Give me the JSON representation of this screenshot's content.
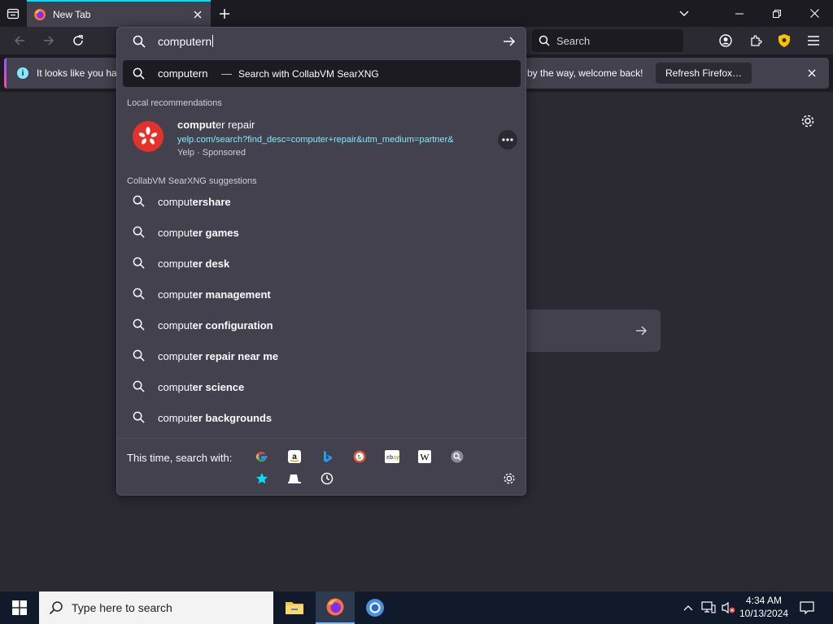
{
  "browser": {
    "tab": {
      "title": "New Tab"
    },
    "navbar": {
      "search_placeholder": "Search"
    },
    "notification": {
      "message_start": "It looks like you ha",
      "message_end": "by the way, welcome back!",
      "button_label": "Refresh Firefox…"
    }
  },
  "urlbar": {
    "input_value": "computern",
    "heuristic": {
      "query": "computern",
      "separator": "—",
      "action": "Search with CollabVM SearXNG"
    },
    "local_recommendations": {
      "label": "Local recommendations",
      "item": {
        "title_bold": "comput",
        "title_rest": "er repair",
        "url": "yelp.com/search?find_desc=computer+repair&utm_medium=partner&",
        "meta": "Yelp · Sponsored"
      }
    },
    "suggestions_label": "CollabVM SearXNG suggestions",
    "suggestions": [
      {
        "prefix": "comput",
        "suffix": "ershare"
      },
      {
        "prefix": "comput",
        "suffix": "er games"
      },
      {
        "prefix": "comput",
        "suffix": "er desk"
      },
      {
        "prefix": "comput",
        "suffix": "er management"
      },
      {
        "prefix": "comput",
        "suffix": "er configuration"
      },
      {
        "prefix": "comput",
        "suffix": "er repair near me"
      },
      {
        "prefix": "comput",
        "suffix": "er science"
      },
      {
        "prefix": "comput",
        "suffix": "er backgrounds"
      }
    ],
    "one_off_label": "This time, search with:",
    "engines": [
      "google-icon",
      "amazon-icon",
      "bing-icon",
      "duckduckgo-icon",
      "ebay-icon",
      "wikipedia-icon",
      "searxng-icon"
    ],
    "modes": [
      "bookmarks-star-icon",
      "tabs-icon",
      "history-clock-icon"
    ]
  },
  "taskbar": {
    "search_placeholder": "Type here to search",
    "time": "4:34 AM",
    "date": "10/13/2024"
  },
  "colors": {
    "accent": "#00ddff",
    "link": "#80ebff",
    "yelp_red": "#e4322b",
    "popup_bg": "#42414d",
    "page_bg": "#2b2a33"
  }
}
